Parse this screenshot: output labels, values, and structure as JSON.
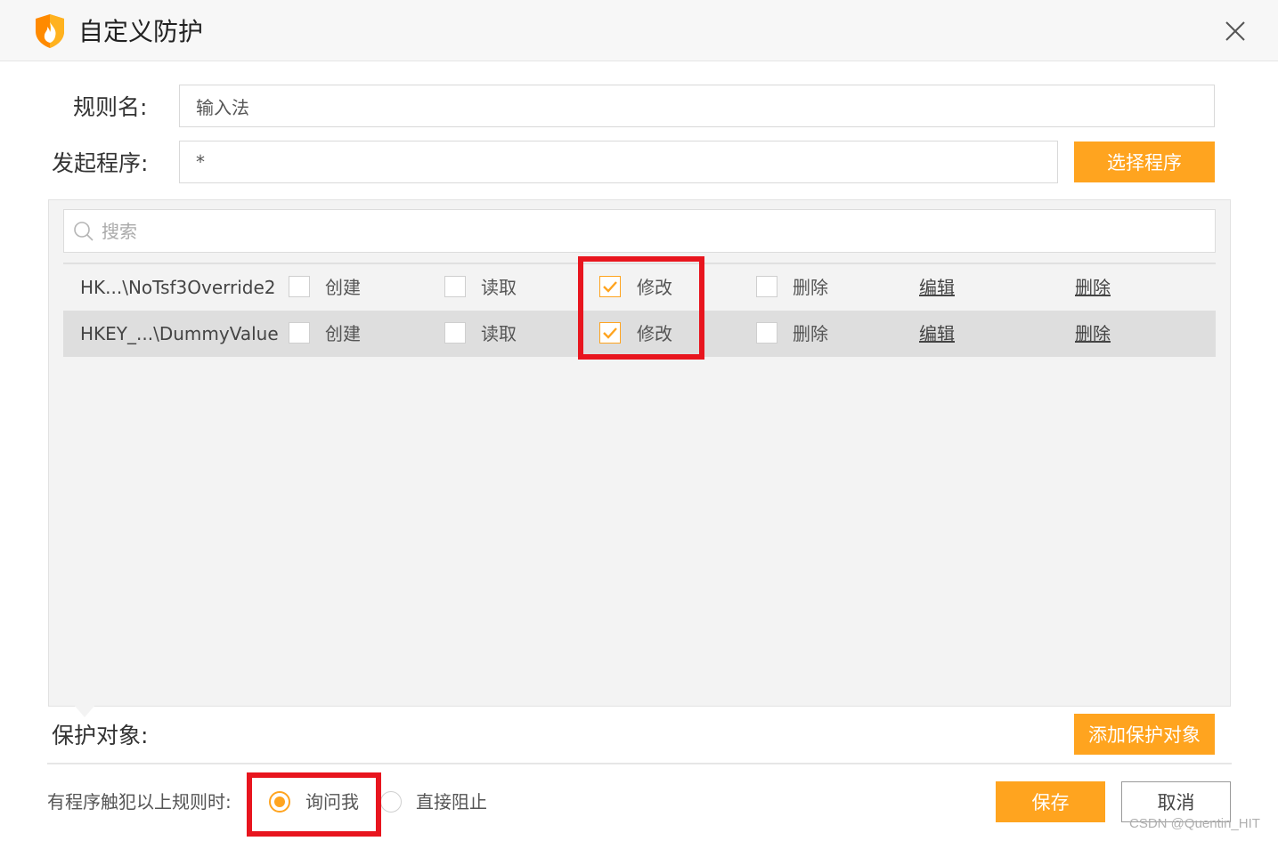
{
  "window": {
    "title": "自定义防护",
    "logo_icon": "shield-flame-icon",
    "close_icon": "close-icon"
  },
  "form": {
    "rule_name_label": "规则名:",
    "rule_name_value": "输入法",
    "initiator_label": "发起程序:",
    "initiator_value": "*",
    "select_program_button": "选择程序"
  },
  "list": {
    "search_placeholder": "搜索",
    "rows": [
      {
        "path": "HK...\\NoTsf3Override2",
        "create_label": "创建",
        "create_checked": false,
        "read_label": "读取",
        "read_checked": false,
        "modify_label": "修改",
        "modify_checked": true,
        "delete_label": "删除",
        "delete_checked": false,
        "edit_link": "编辑",
        "remove_link": "删除"
      },
      {
        "path": "HKEY_...\\DummyValue",
        "create_label": "创建",
        "create_checked": false,
        "read_label": "读取",
        "read_checked": false,
        "modify_label": "修改",
        "modify_checked": true,
        "delete_label": "删除",
        "delete_checked": false,
        "edit_link": "编辑",
        "remove_link": "删除"
      }
    ]
  },
  "protect": {
    "label": "保护对象:",
    "add_button": "添加保护对象"
  },
  "footer": {
    "trigger_label": "有程序触犯以上规则时:",
    "option_ask": "询问我",
    "option_ask_selected": true,
    "option_block": "直接阻止",
    "option_block_selected": false,
    "save_button": "保存",
    "cancel_button": "取消"
  },
  "watermark": "CSDN @Quentin_HIT",
  "colors": {
    "accent": "#ffa41f",
    "highlight_box": "#e8151e"
  }
}
